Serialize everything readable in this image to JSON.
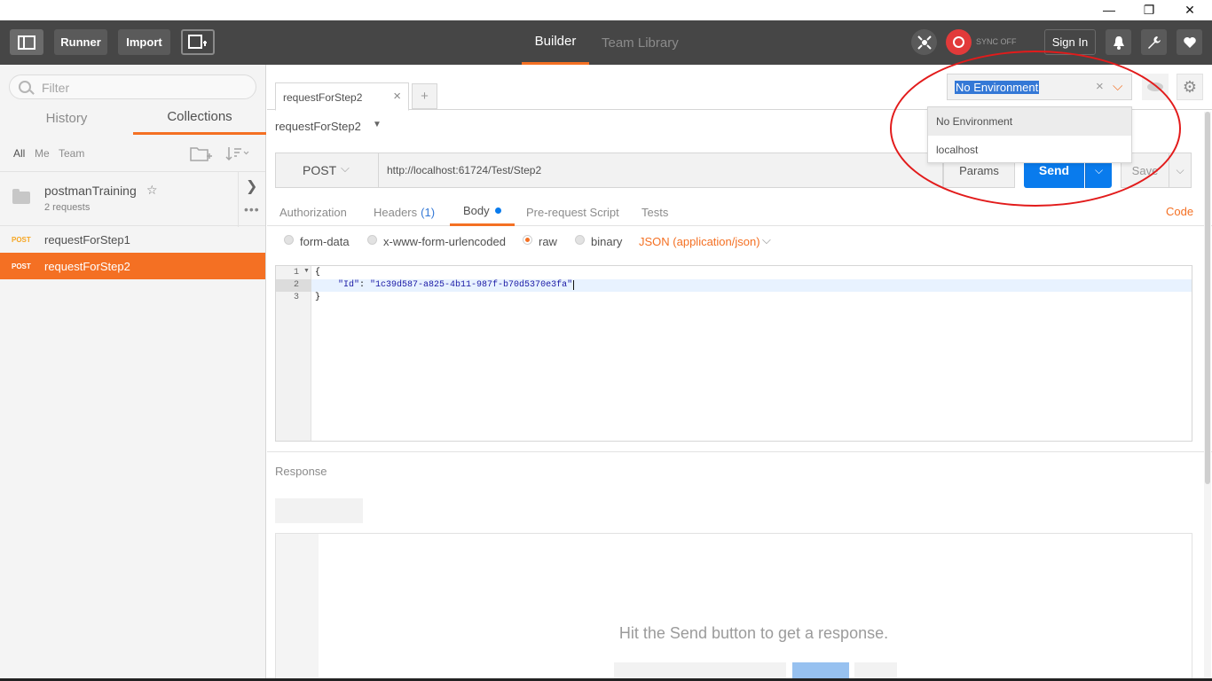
{
  "window": {
    "minimize": "—",
    "restore": "❐",
    "close": "✕"
  },
  "header": {
    "runner_label": "Runner",
    "import_label": "Import",
    "tabs": [
      {
        "label": "Builder",
        "active": true
      },
      {
        "label": "Team Library",
        "active": false
      }
    ],
    "sync_text": "SYNC OFF",
    "signin_label": "Sign In",
    "accent_color": "#f47023"
  },
  "sidebar": {
    "filter_placeholder": "Filter",
    "tabs": {
      "history": "History",
      "collections": "Collections"
    },
    "filters": [
      "All",
      "Me",
      "Team"
    ],
    "collection": {
      "name": "postmanTraining",
      "count": "2 requests"
    },
    "requests": [
      {
        "method": "POST",
        "name": "requestForStep1",
        "active": false
      },
      {
        "method": "POST",
        "name": "requestForStep2",
        "active": true
      }
    ]
  },
  "main": {
    "tab_label": "requestForStep2",
    "add_tab": "+",
    "environment": {
      "selected": "No Environment",
      "options": [
        "No Environment",
        "localhost"
      ]
    },
    "request_title": "requestForStep2",
    "method": "POST",
    "url": "http://localhost:61724/Test/Step2",
    "params_label": "Params",
    "send_label": "Send",
    "save_label": "Save",
    "request_tabs": {
      "authorization": "Authorization",
      "headers": "Headers",
      "headers_count": "(1)",
      "body": "Body",
      "prerequest": "Pre-request Script",
      "tests": "Tests"
    },
    "code_link": "Code",
    "body_options": {
      "form_data": "form-data",
      "urlencoded": "x-www-form-urlencoded",
      "raw": "raw",
      "binary": "binary",
      "content_type": "JSON (application/json)",
      "selected": "raw"
    },
    "editor": {
      "line_numbers": [
        "1",
        "2",
        "3"
      ],
      "line1": "{",
      "line2_key": "\"Id\"",
      "line2_sep": ": ",
      "line2_value": "\"1c39d587-a825-4b11-987f-b70d5370e3fa\"",
      "line3": "}"
    },
    "response_label": "Response",
    "response_hint": "Hit the Send button to get a response."
  }
}
